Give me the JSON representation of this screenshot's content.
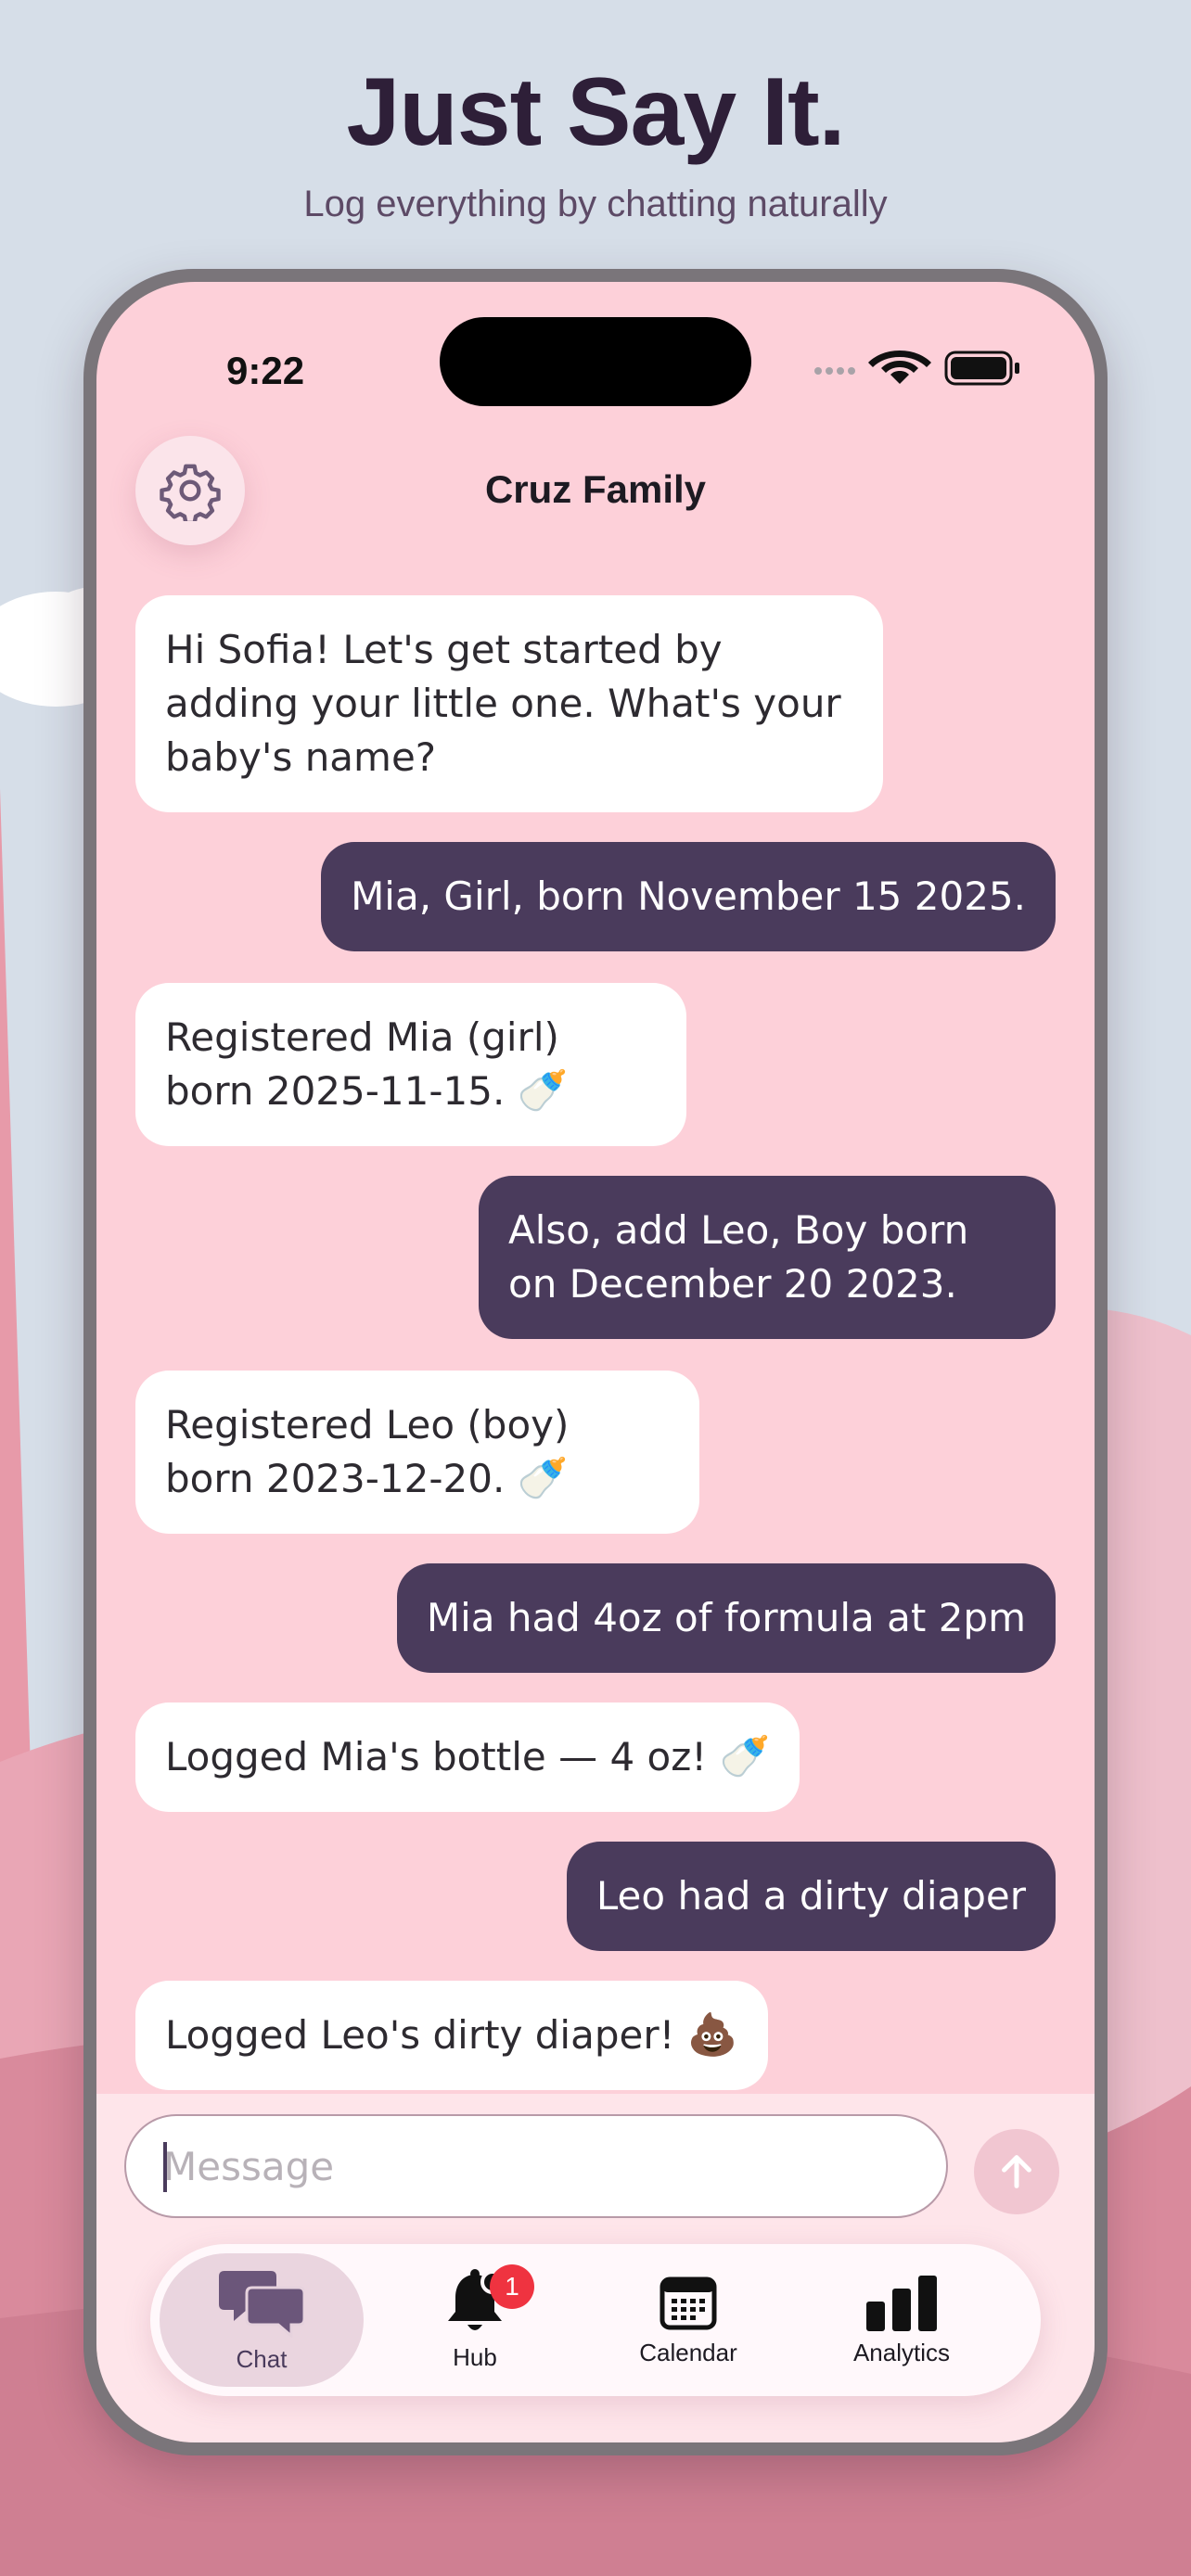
{
  "colors": {
    "background": "#d6dee8",
    "screen": "#fdd0d9",
    "accent": "#4a3b5c",
    "badge": "#ef3340"
  },
  "promo": {
    "headline": "Just Say It.",
    "subheadline": "Log everything by chatting naturally"
  },
  "status_bar": {
    "time": "9:22"
  },
  "chat_header": {
    "title": "Cruz Family",
    "settings_icon": "gear-icon"
  },
  "messages": [
    {
      "sender": "bot",
      "text": "Hi Sofia! Let's get started by adding your little one. What's your baby's name?",
      "emoji": ""
    },
    {
      "sender": "user",
      "text": "Mia, Girl, born November 15 2025.",
      "emoji": ""
    },
    {
      "sender": "bot",
      "text": "Registered Mia (girl) born 2025-11-15.",
      "emoji": "🍼"
    },
    {
      "sender": "user",
      "text": "Also, add Leo, Boy born on December 20 2023.",
      "emoji": ""
    },
    {
      "sender": "bot",
      "text": "Registered Leo (boy) born 2023-12-20.",
      "emoji": "🍼"
    },
    {
      "sender": "user",
      "text": "Mia had 4oz of formula at 2pm",
      "emoji": ""
    },
    {
      "sender": "bot",
      "text": "Logged Mia's bottle — 4 oz!",
      "emoji": "🍼"
    },
    {
      "sender": "user",
      "text": "Leo had a dirty diaper",
      "emoji": ""
    },
    {
      "sender": "bot",
      "text": "Logged Leo's dirty diaper!",
      "emoji": "💩"
    }
  ],
  "composer": {
    "placeholder": "Message",
    "value": "",
    "send_icon": "arrow-up-icon"
  },
  "tabs": [
    {
      "label": "Chat",
      "icon": "chat-bubbles-icon",
      "active": true
    },
    {
      "label": "Hub",
      "icon": "bell-icon",
      "badge": "1"
    },
    {
      "label": "Calendar",
      "icon": "calendar-icon"
    },
    {
      "label": "Analytics",
      "icon": "bar-chart-icon"
    }
  ]
}
